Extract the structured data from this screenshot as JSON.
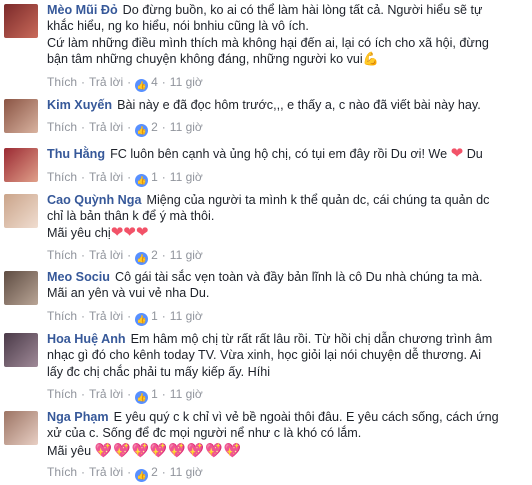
{
  "comments": [
    {
      "name": "Mèo Mũi Đỏ",
      "text_lines": [
        "Do đừng buồn, ko ai có thể làm hài lòng tất cả. Người hiểu sẽ tự",
        "khắc hiểu, ng ko hiểu, nói bnhiu cũng là vô ích.",
        "Cứ làm những điều mình thích mà không hại đến ai, lại có ích cho xã hội, đừng",
        "bận tâm những chuyện không đáng, những người ko vui"
      ],
      "emoji": "💪",
      "actions": {
        "like": "Thích",
        "reply": "Trả lời",
        "likes": "4",
        "time": "11 giờ"
      },
      "avatar_color": "#a23b3b"
    },
    {
      "name": "Kim Xuyến",
      "text_lines": [
        "Bài này e đã đọc hôm trước,,, e thấy a, c nào đã viết bài này hay."
      ],
      "actions": {
        "like": "Thích",
        "reply": "Trả lời",
        "likes": "2",
        "time": "11 giờ"
      },
      "avatar_color": "#9a6a56"
    },
    {
      "name": "Thu Hằng",
      "text_lines": [
        "FC luôn bên cạnh và ủng hộ chị, có tụi em đây rồi Du ơi! We",
        "Du"
      ],
      "actions": {
        "like": "Thích",
        "reply": "Trả lời",
        "likes": "1",
        "time": "11 giờ"
      },
      "avatar_color": "#b0404a"
    },
    {
      "name": "Cao Quỳnh Nga",
      "text_lines": [
        "Miệng của người ta mình k thể quản dc, cái chúng ta quản dc",
        "chỉ là bản thân k để ý mà thôi.",
        "Mãi yêu chị"
      ],
      "actions": {
        "like": "Thích",
        "reply": "Trả lời",
        "likes": "2",
        "time": "11 giờ"
      },
      "avatar_color": "#c9a98e"
    },
    {
      "name": "Meo Sociu",
      "text_lines": [
        "Cô gái tài sắc vẹn toàn và đầy bản lĩnh là cô Du nhà chúng ta mà.",
        "Mãi an yên và vui vẻ nha Du."
      ],
      "actions": {
        "like": "Thích",
        "reply": "Trả lời",
        "likes": "1",
        "time": "11 giờ"
      },
      "avatar_color": "#7a6a5e"
    },
    {
      "name": "Hoa Huệ Anh",
      "text_lines": [
        "Em hâm mộ chị từ rất rất lâu rồi. Từ hồi chị dẫn chương trình âm",
        "nhạc gì đó cho kênh today TV. Vừa xinh, học giỏi lại nói chuyện dễ thương. Ai",
        "lấy đc chị chắc phải tu mấy kiếp ấy. Híhi"
      ],
      "actions": {
        "like": "Thích",
        "reply": "Trả lời",
        "likes": "1",
        "time": "11 giờ"
      },
      "avatar_color": "#6b5a66"
    },
    {
      "name": "Nga Phạm",
      "text_lines": [
        "E yêu quý c k chỉ vì vẻ bề ngoài thôi đâu. E yêu cách sống, cách ứng",
        "xử của c. Sống để đc mọi người nể như c là khó có lắm.",
        "Mãi yêu"
      ],
      "actions": {
        "like": "Thích",
        "reply": "Trả lời",
        "likes": "2",
        "time": "11 giờ"
      },
      "avatar_color": "#b58d7d"
    }
  ],
  "separator": "·",
  "icons": {
    "like_badge": "thumbs-up-icon",
    "heart": "heart-icon",
    "sparkle_heart": "sparkling-heart-icon",
    "flex": "flexed-biceps-icon"
  }
}
